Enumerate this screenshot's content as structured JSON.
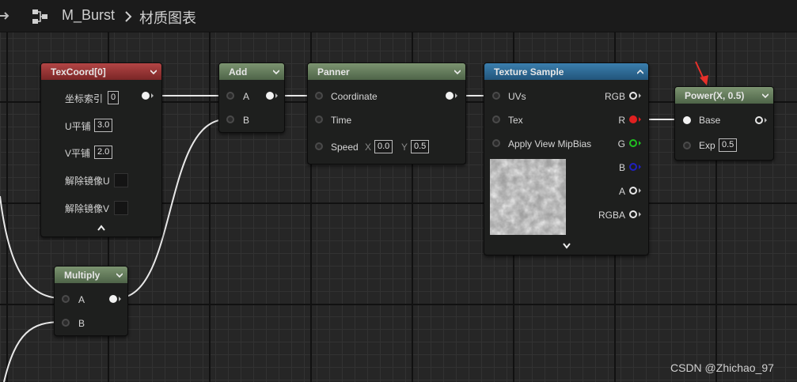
{
  "breadcrumb": {
    "asset": "M_Burst",
    "section": "材质图表"
  },
  "watermark": "CSDN @Zhichao_97",
  "colors": {
    "texcoord_header": "#b34545",
    "math_header": "#6a8260",
    "texture_header": "#2f6c97",
    "pin_r": "#e02020",
    "pin_g": "#20c020",
    "pin_b": "#2020c0",
    "annotation_arrow": "#e8302a"
  },
  "nodes": {
    "texcoord": {
      "title": "TexCoord[0]",
      "coord_label": "坐标索引",
      "coord_value": "0",
      "utile_label": "U平铺",
      "utile_value": "3.0",
      "vtile_label": "V平铺",
      "vtile_value": "2.0",
      "unmirror_u_label": "解除镜像U",
      "unmirror_v_label": "解除镜像V"
    },
    "add": {
      "title": "Add",
      "a": "A",
      "b": "B"
    },
    "panner": {
      "title": "Panner",
      "coordinate": "Coordinate",
      "time": "Time",
      "speed": "Speed",
      "x_label": "X",
      "x_value": "0.0",
      "y_label": "Y",
      "y_value": "0.5"
    },
    "texture": {
      "title": "Texture Sample",
      "uvs": "UVs",
      "tex": "Tex",
      "mip": "Apply View MipBias",
      "rgb": "RGB",
      "r": "R",
      "g": "G",
      "b": "B",
      "a": "A",
      "rgba": "RGBA"
    },
    "power": {
      "title": "Power(X, 0.5)",
      "base": "Base",
      "exp": "Exp",
      "exp_value": "0.5"
    },
    "multiply": {
      "title": "Multiply",
      "a": "A",
      "b": "B"
    }
  },
  "icons": {
    "back": "arrow-right-icon",
    "graph": "graph-icon",
    "separator": "chevron-right-icon"
  }
}
